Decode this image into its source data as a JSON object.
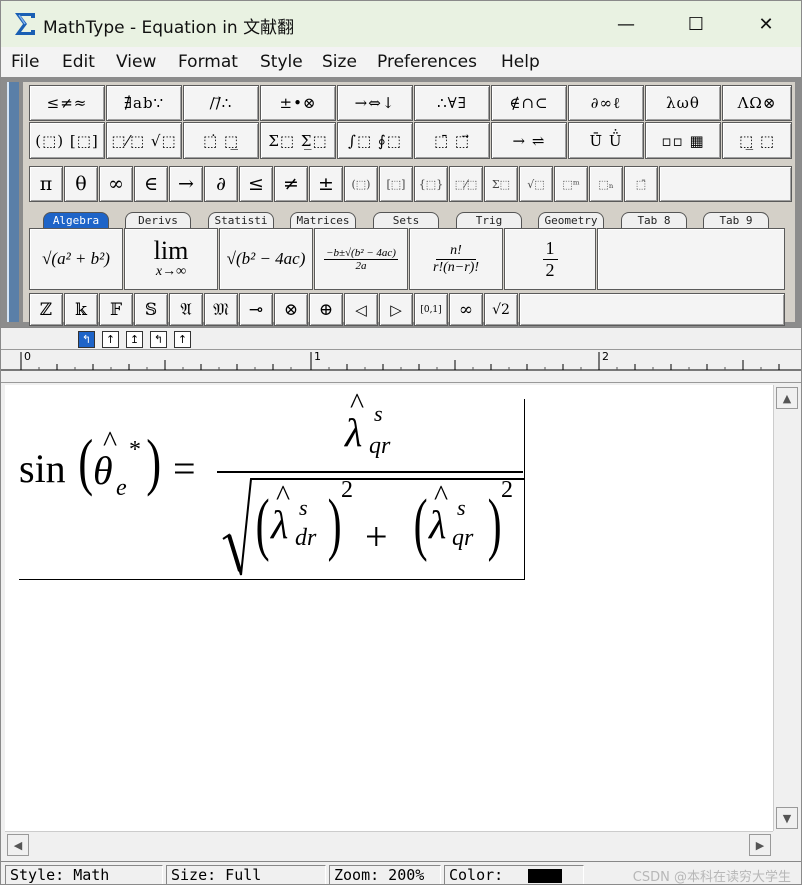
{
  "window": {
    "title": "MathType - Equation in 文献翻",
    "minimize": "—",
    "maximize": "☐",
    "close": "✕"
  },
  "menu": [
    "File",
    "Edit",
    "View",
    "Format",
    "Style",
    "Size",
    "Preferences",
    "Help"
  ],
  "palette_row1": [
    "≤≠≈",
    "∄ab∵",
    "∕∕⃗∴",
    "±•⊗",
    "→⇔↓",
    "∴∀∃",
    "∉∩⊂",
    "∂∞ℓ",
    "λωθ",
    "ΛΩ⊗"
  ],
  "palette_row2": [
    "(⬚) [⬚]",
    "⬚⁄⬚ √⬚",
    "⬚̇ ⬚̲",
    "Σ⬚ Σ̲⬚",
    "∫⬚ ∮⬚",
    "⬚̄ ⬚⃗",
    "→ ⇌",
    "Ū̄ Ü̇",
    "▫▫ ▦",
    "⬚̲ ⬚"
  ],
  "symbol_bar": [
    "π",
    "θ",
    "∞",
    "∈",
    "→",
    "∂",
    "≤",
    "≠",
    "±",
    "(⬚)",
    "[⬚]",
    "{⬚}",
    "⬚⁄⬚",
    "Σ⬚",
    "√⬚",
    "⬚ᵐ",
    "⬚ₙ",
    "⬚̄"
  ],
  "tabs": [
    "Algebra",
    "Derivs",
    "Statisti",
    "Matrices",
    "Sets",
    "Trig",
    "Geometry",
    "Tab 8",
    "Tab 9"
  ],
  "templates": {
    "t1": "√(a² + b²)",
    "t2_top": "lim",
    "t2_bottom": "x→∞",
    "t3": "√(b² − 4ac)",
    "t4_num": "−b±√(b² − 4ac)",
    "t4_den": "2a",
    "t5_num": "n!",
    "t5_den": "r!(n−r)!",
    "t6_num": "1",
    "t6_den": "2"
  },
  "bottom_bar": [
    "ℤ",
    "𝕜",
    "𝔽",
    "𝕊",
    "𝔄",
    "𝔐",
    "⊸",
    "⊗",
    "⊕",
    "◁",
    "▷",
    "[0,1]",
    "∞",
    "√2"
  ],
  "nudge": [
    "↰",
    "↑",
    "↥",
    "↰",
    "↑"
  ],
  "ruler": {
    "labels": [
      "0",
      "1",
      "2"
    ]
  },
  "equation": {
    "lhs_fn": "sin",
    "theta": "θ",
    "theta_hat": "^",
    "theta_sup": "*",
    "theta_sub": "e",
    "equals": "=",
    "num_lambda": "λ",
    "num_hat": "^",
    "num_sup": "s",
    "num_sub": "qr",
    "d1_lambda": "λ",
    "d1_sup": "s",
    "d1_sub": "dr",
    "d1_pow": "2",
    "plus": "+",
    "d2_lambda": "λ",
    "d2_sup": "s",
    "d2_sub": "qr",
    "d2_pow": "2",
    "lparen": "(",
    "rparen": ")"
  },
  "status": {
    "style": "Style: Math",
    "size": "Size: Full",
    "zoom": "Zoom: 200%",
    "color_label": "Color:",
    "watermark": "CSDN @本科在读穷大学生"
  },
  "colors": {
    "title_bg": "#e9f2e2",
    "tab_active": "#1e64c8",
    "app_icon": "#1a5fb4"
  }
}
